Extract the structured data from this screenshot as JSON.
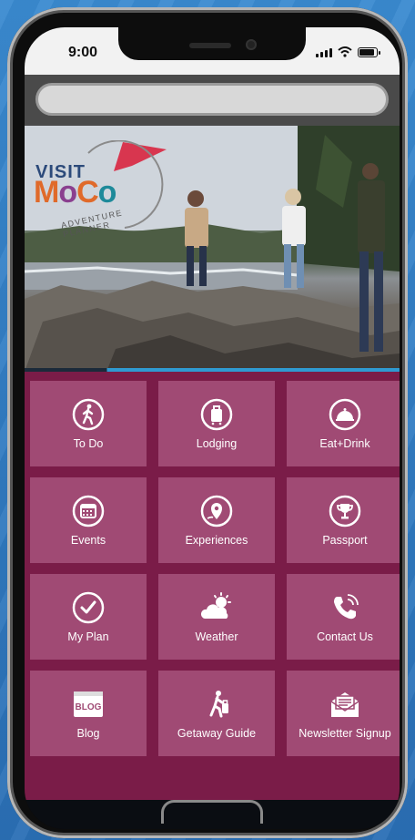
{
  "status": {
    "time": "9:00"
  },
  "logo": {
    "visit": "VISIT",
    "moco": [
      "M",
      "o",
      "C",
      "o"
    ],
    "tagline": "ADVENTURE PLANNER"
  },
  "tiles": [
    {
      "label": "To Do",
      "icon": "walking-person-icon"
    },
    {
      "label": "Lodging",
      "icon": "luggage-icon"
    },
    {
      "label": "Eat+Drink",
      "icon": "dining-cloche-icon"
    },
    {
      "label": "Events",
      "icon": "calendar-icon"
    },
    {
      "label": "Experiences",
      "icon": "map-pin-icon"
    },
    {
      "label": "Passport",
      "icon": "trophy-icon"
    },
    {
      "label": "My Plan",
      "icon": "check-circle-icon"
    },
    {
      "label": "Weather",
      "icon": "weather-icon"
    },
    {
      "label": "Contact Us",
      "icon": "phone-icon"
    },
    {
      "label": "Blog",
      "icon": "blog-icon",
      "icon_text": "BLOG"
    },
    {
      "label": "Getaway Guide",
      "icon": "traveler-icon"
    },
    {
      "label": "Newsletter Signup",
      "icon": "envelope-icon"
    }
  ],
  "colors": {
    "tile": "#a04a74",
    "grid_bg": "#7a1c48",
    "page_bg": "#2f7cc4"
  }
}
